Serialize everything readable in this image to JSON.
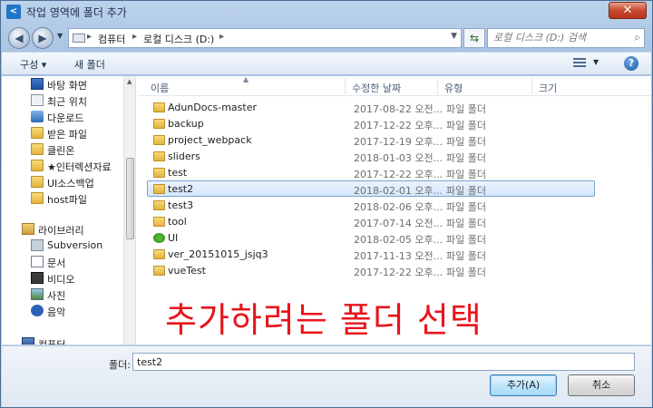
{
  "window": {
    "app_icon": "vs-code-icon",
    "title": "작업 영역에 폴더 추가",
    "close_label": "✕"
  },
  "address": {
    "crumbs": [
      "컴퓨터",
      "로컬 디스크 (D:)"
    ],
    "search_placeholder": "로컬 디스크 (D:) 검색"
  },
  "toolbar": {
    "organize": "구성 ▾",
    "new_folder": "새 폴더",
    "view_dd": "▼",
    "help": "?"
  },
  "nav": {
    "favorites": [
      {
        "label": "바탕 화면",
        "icon": "desktop-icon"
      },
      {
        "label": "최근 위치",
        "icon": "recent-places-icon"
      },
      {
        "label": "다운로드",
        "icon": "downloads-icon"
      },
      {
        "label": "받은 파일",
        "icon": "folder-icon"
      },
      {
        "label": "클린온",
        "icon": "folder-icon"
      },
      {
        "label": "★인터렉션자료",
        "icon": "star-folder-icon"
      },
      {
        "label": "UI소스백업",
        "icon": "folder-icon"
      },
      {
        "label": "host파일",
        "icon": "folder-icon"
      }
    ],
    "libraries_label": "라이브러리",
    "libraries": [
      {
        "label": "Subversion",
        "icon": "subversion-icon"
      },
      {
        "label": "문서",
        "icon": "documents-icon"
      },
      {
        "label": "비디오",
        "icon": "video-icon"
      },
      {
        "label": "사진",
        "icon": "pictures-icon"
      },
      {
        "label": "음악",
        "icon": "music-icon"
      }
    ],
    "computer_label": "컴퓨터"
  },
  "columns": {
    "name": "이름",
    "modified": "수정한 날짜",
    "type": "유형",
    "size": "크기"
  },
  "files": [
    {
      "name": "AdunDocs-master",
      "date": "2017-08-22 오전...",
      "type": "파일 폴더",
      "icon": "folder-icon"
    },
    {
      "name": "backup",
      "date": "2017-12-22 오후...",
      "type": "파일 폴더",
      "icon": "folder-icon"
    },
    {
      "name": "project_webpack",
      "date": "2017-12-19 오후...",
      "type": "파일 폴더",
      "icon": "folder-icon"
    },
    {
      "name": "sliders",
      "date": "2018-01-03 오전...",
      "type": "파일 폴더",
      "icon": "folder-icon"
    },
    {
      "name": "test",
      "date": "2017-12-22 오후...",
      "type": "파일 폴더",
      "icon": "folder-icon"
    },
    {
      "name": "test2",
      "date": "2018-02-01 오후...",
      "type": "파일 폴더",
      "icon": "folder-icon",
      "selected": true
    },
    {
      "name": "test3",
      "date": "2018-02-06 오후...",
      "type": "파일 폴더",
      "icon": "folder-icon"
    },
    {
      "name": "tool",
      "date": "2017-07-14 오전...",
      "type": "파일 폴더",
      "icon": "folder-icon"
    },
    {
      "name": "UI",
      "date": "2018-02-05 오후...",
      "type": "파일 폴더",
      "icon": "svn-ok-folder-icon"
    },
    {
      "name": "ver_20151015_jsjq3",
      "date": "2017-11-13 오전...",
      "type": "파일 폴더",
      "icon": "folder-icon"
    },
    {
      "name": "vueTest",
      "date": "2017-12-22 오후...",
      "type": "파일 폴더",
      "icon": "folder-icon"
    }
  ],
  "annotation": "추가하려는 폴더 선택",
  "bottom": {
    "folder_label": "폴더:",
    "folder_value": "test2",
    "add_button": "추가(A)",
    "cancel_button": "취소"
  },
  "colors": {
    "annotation": "#e8151b",
    "selection": "#d4e7fb"
  }
}
